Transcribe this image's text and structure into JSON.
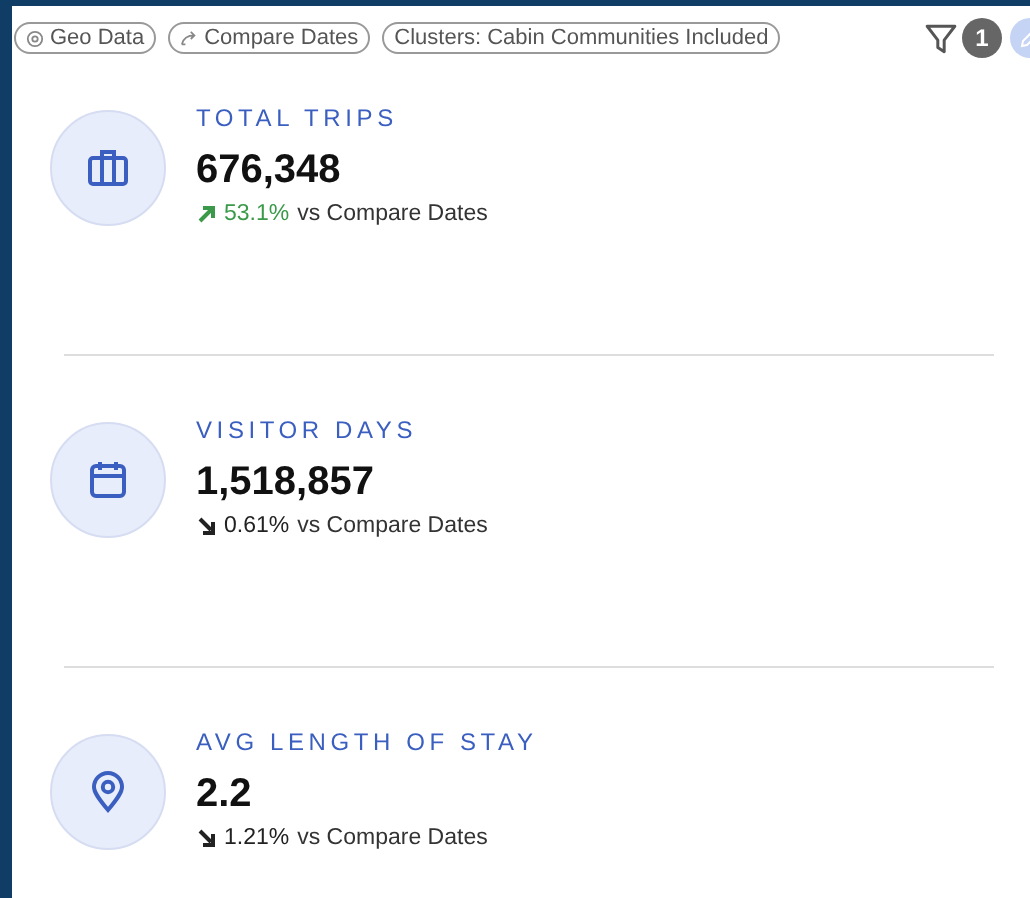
{
  "chips": [
    {
      "label": "Geo Data",
      "kind": "geo"
    },
    {
      "label": "Compare Dates",
      "kind": "compare"
    },
    {
      "label": "Clusters: Cabin Communities Included",
      "kind": "plain"
    }
  ],
  "filter_count": "1",
  "metrics": [
    {
      "title": "TOTAL TRIPS",
      "value": "676,348",
      "change": "53.1%",
      "kind": "rise",
      "comparison": "vs Compare Dates"
    },
    {
      "title": "VISITOR DAYS",
      "value": "1,518,857",
      "change": "0.61%",
      "kind": "fall",
      "comparison": "vs Compare Dates"
    },
    {
      "title": "AVG LENGTH OF STAY",
      "value": "2.2",
      "change": "1.21%",
      "kind": "fall",
      "comparison": "vs Compare Dates"
    }
  ]
}
